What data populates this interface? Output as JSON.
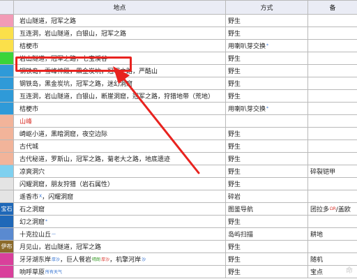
{
  "table": {
    "headers": [
      "",
      "地点",
      "方式",
      "备"
    ],
    "rows": [
      {
        "swatch": "#f29bb6",
        "badge": "",
        "location": "岩山隧道，冠军之路",
        "method": "野生",
        "method_sup": "",
        "note": ""
      },
      {
        "swatch": "#fbe04a",
        "badge": "",
        "location": "互连洞，岩山隧道，白银山，冠军之路",
        "method": "野生",
        "method_sup": "",
        "note": ""
      },
      {
        "swatch": "#fbe04a",
        "badge": "",
        "location": "桔梗市",
        "method": "用喇叭芽交换",
        "method_sup": "*",
        "note": ""
      },
      {
        "swatch": "#3ad43a",
        "badge": "",
        "location": "岩山隧道，冠军之路，七宝溪谷",
        "method": "野生",
        "method_sup": "",
        "note": ""
      },
      {
        "swatch": "#2f9ad8",
        "badge": "",
        "location": "钢铁岛，雪峰神殿，黑金炭坑，冠军之路，严酷山",
        "method": "野生",
        "method_sup": "",
        "note": ""
      },
      {
        "swatch": "#2f9ad8",
        "badge": "",
        "location": "钢铁岛，黑金炭坑，冠军之路，迷幻洞窟",
        "method": "野生",
        "method_sup": "",
        "note": ""
      },
      {
        "swatch": "#2f9ad8",
        "badge": "",
        "location": "互连洞，岩山隧道，白银山，断崖洞窟，冠军之路，狩猎地带（荒地）",
        "method": "野生",
        "method_sup": "",
        "note": ""
      },
      {
        "swatch": "#2f9ad8",
        "badge": "",
        "location": "桔梗市",
        "method": "用喇叭芽交换",
        "method_sup": "*",
        "note": ""
      },
      {
        "swatch": "#f2b49a",
        "badge": "",
        "location": "山峰",
        "location_red": true,
        "method": "",
        "method_sup": "",
        "note": ""
      },
      {
        "swatch": "#f2b49a",
        "badge": "",
        "location": "崎岖小道，黑暗洞窟，夜空边际",
        "method": "野生",
        "method_sup": "",
        "note": ""
      },
      {
        "swatch": "#f2b49a",
        "badge": "",
        "location": "古代城",
        "method": "野生",
        "method_sup": "",
        "note": ""
      },
      {
        "swatch": "#f2b49a",
        "badge": "",
        "location": "古代秘道，罗斯山，冠军之路，菊老大之路，地底遗迹",
        "method": "野生",
        "method_sup": "",
        "note": ""
      },
      {
        "swatch": "#7fd0ef",
        "badge": "",
        "location": "凉爽洞穴",
        "method": "野生",
        "method_sup": "",
        "note": "碎裂铠甲"
      },
      {
        "swatch": "#e4e4e4",
        "badge": "",
        "location": "闪耀洞窟，朋友狩猎（岩石属性）",
        "method": "野生",
        "method_sup": "",
        "note": ""
      },
      {
        "swatch": "#e4e4e4",
        "badge": "",
        "location": "遥香市",
        "location_sup": "X",
        "location_tail": "，闪耀洞窟",
        "method": "碎岩",
        "method_sup": "",
        "note": ""
      },
      {
        "swatch": "#1f68b8",
        "badge": "宝石",
        "location": "石之洞窟",
        "method": "图鉴导航",
        "method_sup": "",
        "note": "团拉多",
        "note_sup": "ΩR",
        "note_tail": "/盖欧"
      },
      {
        "swatch": "#1f68b8",
        "badge": "",
        "location": "幻之洞窟",
        "location_sup": "*",
        "method": "野生",
        "method_sup": "",
        "note": ""
      },
      {
        "swatch": "#5a8ad0",
        "badge": "",
        "location": "十克拉山丘",
        "location_sup": "—",
        "method": "岛屿扫描",
        "method_sup": "",
        "note": "耕地"
      },
      {
        "swatch": "#8b6a2a",
        "badge": "伊布",
        "location": "月见山，岩山隧道，冠军之路",
        "method": "野生",
        "method_sup": "",
        "note": ""
      },
      {
        "swatch": "#d9409b",
        "badge": "",
        "location": "牙牙湖东岸",
        "location_sup": "厚沙",
        "location_tail": "，巨人餐岩",
        "location_sup2": "晴朗",
        "location_sup3": "厚沙",
        "location_tail2": "，机擎河岸",
        "location_sup4": "沙",
        "method": "野生",
        "method_sup": "",
        "note": "随机"
      },
      {
        "swatch": "#d9409b",
        "badge": "",
        "location": "响呼草原",
        "location_sup": "所有天气",
        "method": "野生",
        "method_sup": "",
        "note": "宝点"
      }
    ]
  },
  "watermark": "命"
}
